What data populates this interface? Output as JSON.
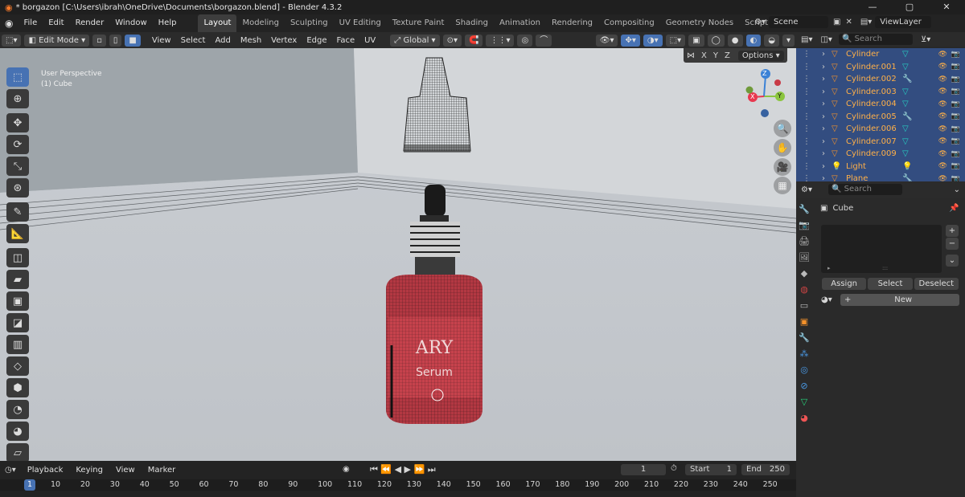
{
  "window": {
    "title": "* borgazon [C:\\Users\\ibrah\\OneDrive\\Documents\\borgazon.blend] - Blender 4.3.2",
    "minimize": "—",
    "maximize": "▢",
    "close": "✕"
  },
  "menus": [
    "File",
    "Edit",
    "Render",
    "Window",
    "Help"
  ],
  "workspaces": [
    "Layout",
    "Modeling",
    "Sculpting",
    "UV Editing",
    "Texture Paint",
    "Shading",
    "Animation",
    "Rendering",
    "Compositing",
    "Geometry Nodes",
    "Scripting"
  ],
  "active_workspace": "Layout",
  "add_workspace": "+",
  "scene": {
    "label": "Scene",
    "viewlayer": "ViewLayer"
  },
  "header3d": {
    "mode": "Edit Mode",
    "menus": [
      "View",
      "Select",
      "Add",
      "Mesh",
      "Vertex",
      "Edge",
      "Face",
      "UV"
    ],
    "transform": "Global",
    "options": "Options",
    "axes": [
      "X",
      "Y",
      "Z"
    ]
  },
  "viewport": {
    "perspective": "User Perspective",
    "object": "(1) Cube",
    "label_text": "ARY",
    "label_sub": "Serum"
  },
  "gizmo": {
    "x": "X",
    "y": "Y",
    "z": "Z",
    "colors": {
      "x": "#e8384f",
      "y": "#8bc53f",
      "z": "#3b82d6"
    }
  },
  "outliner": {
    "search_placeholder": "Search",
    "items": [
      {
        "name": "Cylinder",
        "icon": "mesh-data-icon"
      },
      {
        "name": "Cylinder.001",
        "icon": "mesh-data-icon"
      },
      {
        "name": "Cylinder.002",
        "icon": "wrench-icon"
      },
      {
        "name": "Cylinder.003",
        "icon": "mesh-data-icon"
      },
      {
        "name": "Cylinder.004",
        "icon": "mesh-data-icon"
      },
      {
        "name": "Cylinder.005",
        "icon": "wrench-icon"
      },
      {
        "name": "Cylinder.006",
        "icon": "mesh-data-icon"
      },
      {
        "name": "Cylinder.007",
        "icon": "mesh-data-icon"
      },
      {
        "name": "Cylinder.009",
        "icon": "mesh-data-icon"
      },
      {
        "name": "Light",
        "icon": "light-data-icon"
      },
      {
        "name": "Plane",
        "icon": "wrench-icon"
      }
    ]
  },
  "properties": {
    "search_placeholder": "Search",
    "object": "Cube",
    "buttons": {
      "assign": "Assign",
      "select": "Select",
      "deselect": "Deselect",
      "new": "New"
    }
  },
  "timeline": {
    "menus": [
      "Playback",
      "Keying",
      "View",
      "Marker"
    ],
    "current_frame": "1",
    "start_label": "Start",
    "start": "1",
    "end_label": "End",
    "end": "250",
    "ruler": [
      "1",
      "10",
      "20",
      "30",
      "40",
      "50",
      "60",
      "70",
      "80",
      "90",
      "100",
      "110",
      "120",
      "130",
      "140",
      "150",
      "160",
      "170",
      "180",
      "190",
      "200",
      "210",
      "220",
      "230",
      "240",
      "250"
    ]
  },
  "colors": {
    "accent": "#4772b3",
    "selected_row": "#334d80",
    "orange": "#ffb048",
    "teal": "#26d1c4"
  }
}
